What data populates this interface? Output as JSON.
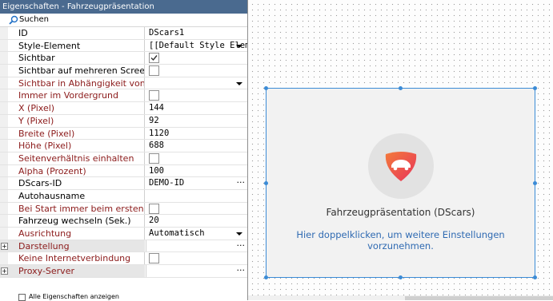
{
  "panel": {
    "title": "Eigenschaften - Fahrzeugpräsentation",
    "search_label": "Suchen",
    "footer_label": "Alle Eigenschaften anzeigen"
  },
  "properties": [
    {
      "name": "ID",
      "value": "DScars1",
      "kind": "text",
      "red": false
    },
    {
      "name": "Style-Element",
      "value": "[[Default Style Element",
      "kind": "dropdown",
      "red": false
    },
    {
      "name": "Sichtbar",
      "value": "",
      "kind": "checkbox",
      "checked": true,
      "red": false
    },
    {
      "name": "Sichtbar auf mehreren Screens",
      "value": "",
      "kind": "checkbox",
      "checked": false,
      "red": false
    },
    {
      "name": "Sichtbar in Abhängigkeit von",
      "value": "",
      "kind": "dropdown",
      "red": true
    },
    {
      "name": "Immer im Vordergrund",
      "value": "",
      "kind": "checkbox",
      "checked": false,
      "red": true
    },
    {
      "name": "X (Pixel)",
      "value": "144",
      "kind": "text",
      "red": true
    },
    {
      "name": "Y (Pixel)",
      "value": "92",
      "kind": "text",
      "red": true
    },
    {
      "name": "Breite (Pixel)",
      "value": "1120",
      "kind": "text",
      "red": true
    },
    {
      "name": "Höhe (Pixel)",
      "value": "688",
      "kind": "text",
      "red": true
    },
    {
      "name": "Seitenverhältnis einhalten",
      "value": "",
      "kind": "checkbox",
      "checked": false,
      "red": true
    },
    {
      "name": "Alpha (Prozent)",
      "value": "100",
      "kind": "text",
      "red": true
    },
    {
      "name": "DScars-ID",
      "value": "DEMO-ID",
      "kind": "ellipsis",
      "red": false
    },
    {
      "name": "Autohausname",
      "value": "",
      "kind": "text",
      "red": false
    },
    {
      "name": "Bei Start immer beim ersten Fahr",
      "value": "",
      "kind": "checkbox",
      "checked": false,
      "red": true
    },
    {
      "name": "Fahrzeug wechseln (Sek.)",
      "value": "20",
      "kind": "text",
      "red": false
    },
    {
      "name": "Ausrichtung",
      "value": "Automatisch",
      "kind": "dropdown",
      "red": true
    },
    {
      "name": "Darstellung",
      "value": "",
      "kind": "category-ellipsis",
      "red": true,
      "expander": "+"
    },
    {
      "name": "Keine Internetverbindung",
      "value": "",
      "kind": "checkbox",
      "checked": false,
      "red": true
    },
    {
      "name": "Proxy-Server",
      "value": "",
      "kind": "category-ellipsis",
      "red": true,
      "expander": "+"
    }
  ],
  "canvas": {
    "component_title": "Fahrzeugpräsentation (DScars)",
    "component_hint": "Hier doppelklicken, um weitere Einstellungen vorzunehmen.",
    "logo_icon": "car-logo-icon",
    "accent": "#3b8bd6",
    "logo_gradient": [
      "#f37b3b",
      "#e8335a"
    ]
  }
}
